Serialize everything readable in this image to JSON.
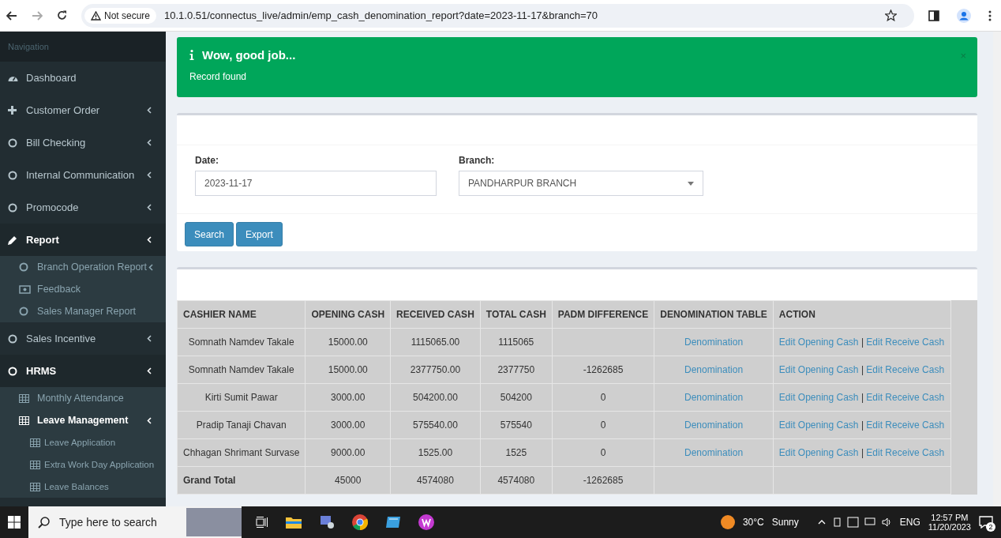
{
  "browser": {
    "security_label": "Not secure",
    "url": "10.1.0.51/connectus_live/admin/emp_cash_denomination_report?date=2023-11-17&branch=70",
    "forward_disabled": true
  },
  "sidebar": {
    "header": "Navigation",
    "items": [
      {
        "label": "Dashboard",
        "kind": "dashboard",
        "has_submenu": false,
        "selected": false
      },
      {
        "label": "Customer Order",
        "kind": "plus",
        "has_submenu": true,
        "selected": false
      },
      {
        "label": "Bill Checking",
        "kind": "circle",
        "has_submenu": true,
        "selected": false
      },
      {
        "label": "Internal Communication",
        "kind": "circle",
        "has_submenu": true,
        "selected": false
      },
      {
        "label": "Promocode",
        "kind": "circle",
        "has_submenu": true,
        "selected": false
      },
      {
        "label": "Report",
        "kind": "pencil",
        "has_submenu": true,
        "selected": true,
        "children": [
          {
            "label": "Branch Operation Report",
            "kind": "circle",
            "has_submenu": true,
            "selected": false
          },
          {
            "label": "Feedback",
            "kind": "money",
            "has_submenu": false,
            "selected": false
          },
          {
            "label": "Sales Manager Report",
            "kind": "circle",
            "has_submenu": false,
            "selected": false
          }
        ]
      },
      {
        "label": "Sales Incentive",
        "kind": "circle",
        "has_submenu": true,
        "selected": false
      },
      {
        "label": "HRMS",
        "kind": "circle",
        "has_submenu": true,
        "selected": true,
        "children": [
          {
            "label": "Monthly Attendance",
            "kind": "table",
            "has_submenu": false,
            "selected": false
          },
          {
            "label": "Leave Management",
            "kind": "table",
            "has_submenu": true,
            "selected": true,
            "children": [
              {
                "label": "Leave Application",
                "kind": "table",
                "has_submenu": false,
                "selected": false
              },
              {
                "label": "Extra Work Day Application",
                "kind": "table",
                "has_submenu": false,
                "selected": false
              },
              {
                "label": "Leave Balances",
                "kind": "table",
                "has_submenu": false,
                "selected": false
              }
            ]
          }
        ]
      }
    ]
  },
  "alert": {
    "title": "Wow, good job...",
    "message": "Record found",
    "close": "×"
  },
  "filters": {
    "date_label": "Date:",
    "date_value": "2023-11-17",
    "branch_label": "Branch:",
    "branch_value": "PANDHARPUR BRANCH"
  },
  "buttons": [
    "Search",
    "Export"
  ],
  "table": {
    "columns": [
      "CASHIER NAME",
      "OPENING CASH",
      "RECEIVED CASH",
      "TOTAL CASH",
      "PADM DIFFERENCE",
      "DENOMINATION TABLE",
      "ACTION"
    ],
    "rows": [
      {
        "cashier": "Somnath Namdev Takale",
        "opening": "15000.00",
        "received": "1115065.00",
        "total": "1115065",
        "difference": "",
        "denomination": "Denomination",
        "edit_opening": "Edit Opening Cash",
        "separator": "|",
        "edit_receive": "Edit Receive Cash"
      },
      {
        "cashier": "Somnath Namdev Takale",
        "opening": "15000.00",
        "received": "2377750.00",
        "total": "2377750",
        "difference": "-1262685",
        "denomination": "Denomination",
        "edit_opening": "Edit Opening Cash",
        "separator": "|",
        "edit_receive": "Edit Receive Cash"
      },
      {
        "cashier": "Kirti Sumit Pawar",
        "opening": "3000.00",
        "received": "504200.00",
        "total": "504200",
        "difference": "0",
        "denomination": "Denomination",
        "edit_opening": "Edit Opening Cash",
        "separator": "|",
        "edit_receive": "Edit Receive Cash"
      },
      {
        "cashier": "Pradip Tanaji Chavan",
        "opening": "3000.00",
        "received": "575540.00",
        "total": "575540",
        "difference": "0",
        "denomination": "Denomination",
        "edit_opening": "Edit Opening Cash",
        "separator": "|",
        "edit_receive": "Edit Receive Cash"
      },
      {
        "cashier": "Chhagan Shrimant Survase",
        "opening": "9000.00",
        "received": "1525.00",
        "total": "1525",
        "difference": "0",
        "denomination": "Denomination",
        "edit_opening": "Edit Opening Cash",
        "separator": "|",
        "edit_receive": "Edit Receive Cash"
      }
    ],
    "total": {
      "label": "Grand Total",
      "opening": "45000",
      "received": "4574080",
      "total": "4574080",
      "difference": "-1262685"
    }
  },
  "taskbar": {
    "search_placeholder": "Type here to search",
    "temperature": "30°C",
    "weather": "Sunny",
    "language": "ENG",
    "time": "12:57 PM",
    "date": "11/20/2023",
    "notifications": "2"
  }
}
